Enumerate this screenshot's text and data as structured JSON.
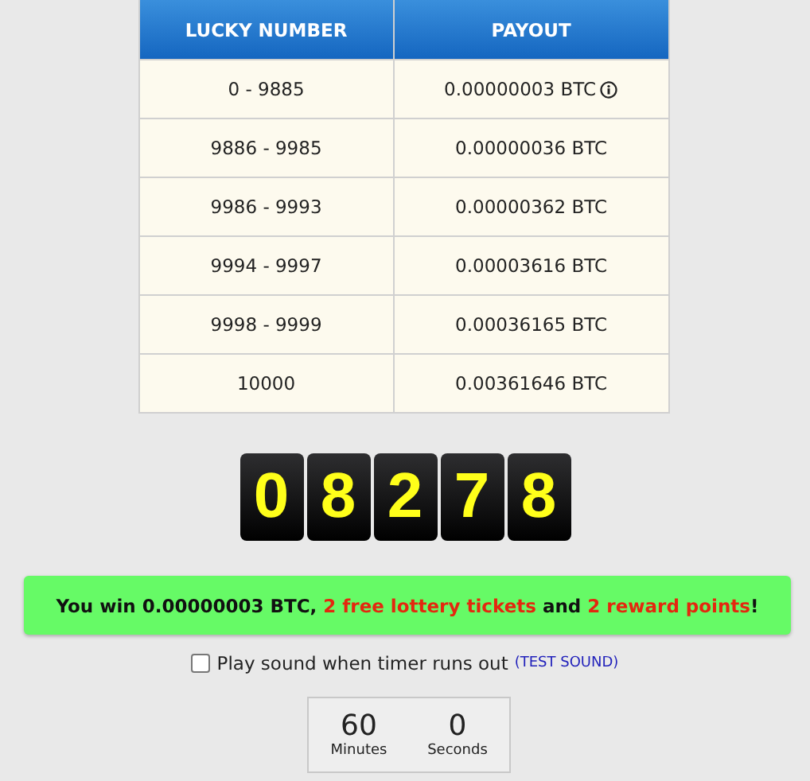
{
  "table": {
    "columns": [
      "LUCKY NUMBER",
      "PAYOUT"
    ],
    "rows": [
      {
        "range": "0 - 9885",
        "payout": "0.00000003 BTC",
        "info": true
      },
      {
        "range": "9886 - 9985",
        "payout": "0.00000036 BTC",
        "info": false
      },
      {
        "range": "9986 - 9993",
        "payout": "0.00000362 BTC",
        "info": false
      },
      {
        "range": "9994 - 9997",
        "payout": "0.00003616 BTC",
        "info": false
      },
      {
        "range": "9998 - 9999",
        "payout": "0.00036165 BTC",
        "info": false
      },
      {
        "range": "10000",
        "payout": "0.00361646 BTC",
        "info": false
      }
    ]
  },
  "roll_digits": [
    "0",
    "8",
    "2",
    "7",
    "8"
  ],
  "win_message": [
    {
      "text": "You win 0.00000003 BTC, ",
      "highlight": false
    },
    {
      "text": "2 free lottery tickets",
      "highlight": true
    },
    {
      "text": " and ",
      "highlight": false
    },
    {
      "text": "2 reward points",
      "highlight": true
    },
    {
      "text": "!",
      "highlight": false
    }
  ],
  "sound_option": {
    "label": "Play sound when timer runs out",
    "checked": false,
    "link": "(TEST SOUND)"
  },
  "timer": [
    {
      "value": "60",
      "unit": "Minutes"
    },
    {
      "value": "0",
      "unit": "Seconds"
    }
  ]
}
